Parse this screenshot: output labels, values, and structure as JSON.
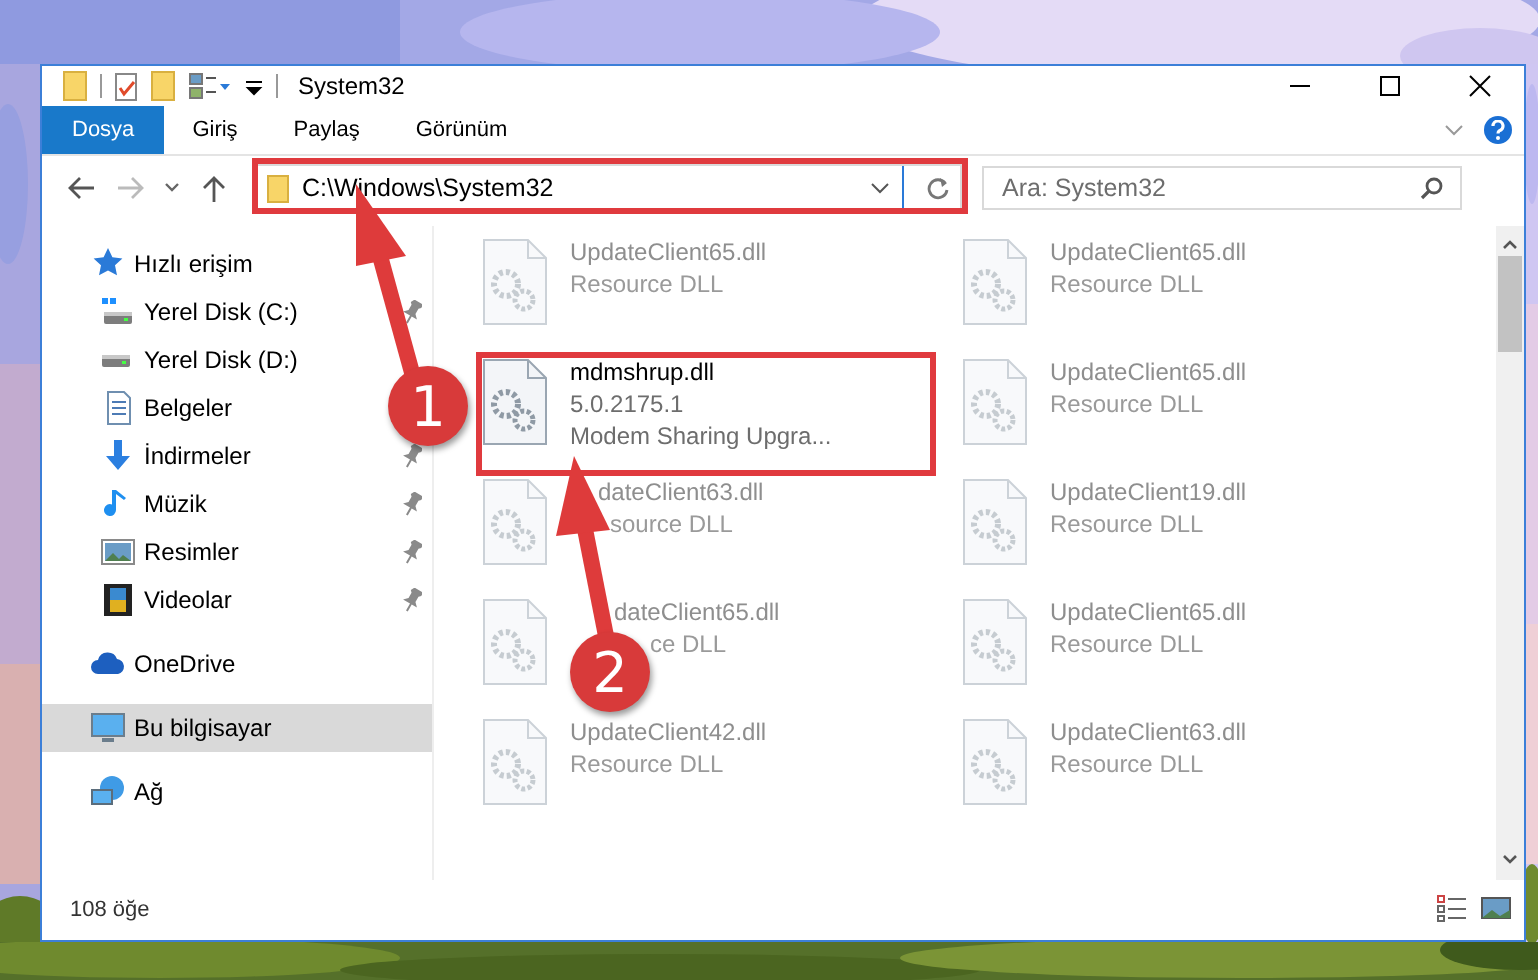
{
  "window": {
    "title": "System32"
  },
  "ribbon": {
    "tabs": [
      {
        "label": "Dosya",
        "kind": "file-menu",
        "selected": false
      },
      {
        "label": "Giriş",
        "kind": "tab",
        "selected": false
      },
      {
        "label": "Paylaş",
        "kind": "tab",
        "selected": false
      },
      {
        "label": "Görünüm",
        "kind": "tab",
        "selected": false
      }
    ]
  },
  "address_bar": {
    "path": "C:\\Windows\\System32"
  },
  "search": {
    "placeholder": "Ara: System32"
  },
  "sidebar": {
    "items": [
      {
        "label": "Hızlı erişim",
        "kind": "quick-access",
        "selected": false,
        "children": [
          {
            "label": "Yerel Disk (C:)",
            "kind": "system-drive",
            "pinned": true,
            "selected": false
          },
          {
            "label": "Yerel Disk (D:)",
            "kind": "drive",
            "pinned": false,
            "selected": false
          },
          {
            "label": "Belgeler",
            "kind": "documents",
            "pinned": false,
            "selected": false
          },
          {
            "label": "İndirmeler",
            "kind": "downloads",
            "pinned": true,
            "selected": false
          },
          {
            "label": "Müzik",
            "kind": "music",
            "pinned": true,
            "selected": false
          },
          {
            "label": "Resimler",
            "kind": "pictures",
            "pinned": true,
            "selected": false
          },
          {
            "label": "Videolar",
            "kind": "videos",
            "pinned": true,
            "selected": false
          }
        ]
      },
      {
        "label": "OneDrive",
        "kind": "cloud",
        "selected": false
      },
      {
        "label": "Bu bilgisayar",
        "kind": "computer",
        "selected": true
      },
      {
        "label": "Ağ",
        "kind": "network",
        "selected": false
      }
    ]
  },
  "files": {
    "items": [
      {
        "name": "UpdateClient65.dll",
        "description": "Resource DLL",
        "blurred": true
      },
      {
        "name": "UpdateClient65.dll",
        "description": "Resource DLL",
        "blurred": true
      },
      {
        "name": "mdmshrup.dll",
        "version": "5.0.2175.1",
        "description": "Modem Sharing Upgra...",
        "blurred": false
      },
      {
        "name": "UpdateClient65.dll",
        "description": "Resource DLL",
        "blurred": true
      },
      {
        "name": "dateClient63.dll",
        "description": "source DLL",
        "blurred": true
      },
      {
        "name": "UpdateClient19.dll",
        "description": "Resource DLL",
        "blurred": true
      },
      {
        "name": "dateClient65.dll",
        "description": "ce DLL",
        "blurred": true
      },
      {
        "name": "UpdateClient65.dll",
        "description": "Resource DLL",
        "blurred": true
      },
      {
        "name": "UpdateClient42.dll",
        "description": "Resource DLL",
        "blurred": true
      },
      {
        "name": "UpdateClient63.dll",
        "description": "Resource DLL",
        "blurred": true
      }
    ]
  },
  "status_bar": {
    "count": "108 öğe"
  },
  "annotations": [
    {
      "label": "1"
    },
    {
      "label": "2"
    }
  ]
}
